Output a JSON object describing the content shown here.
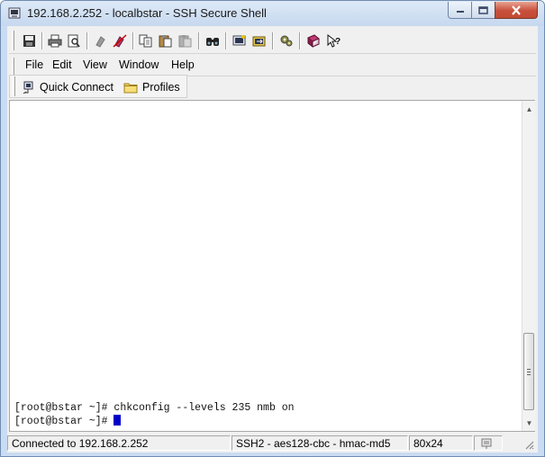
{
  "window": {
    "title": "192.168.2.252 - localbstar - SSH Secure Shell"
  },
  "menu": {
    "items": [
      "File",
      "Edit",
      "View",
      "Window",
      "Help"
    ]
  },
  "linkbar": {
    "quick_connect": "Quick Connect",
    "profiles": "Profiles"
  },
  "terminal": {
    "lines": [
      "[root@bstar ~]# chkconfig --levels 235 nmb on",
      "[root@bstar ~]# "
    ]
  },
  "status": {
    "connection": "Connected to 192.168.2.252",
    "encryption": "SSH2 - aes128-cbc - hmac-md5",
    "size": "80x24"
  },
  "icons": {
    "toolbar": [
      "save-icon",
      "print-icon",
      "print-preview-icon",
      "disconnect-icon",
      "connect-icon",
      "copy-icon",
      "paste-icon",
      "paste-disabled-icon",
      "find-icon",
      "new-terminal-icon",
      "file-transfer-icon",
      "settings-icon",
      "help-book-icon",
      "context-help-icon"
    ]
  },
  "colors": {
    "titlebar": "#c9dcf2",
    "close_button": "#c8503c",
    "cursor": "#0000c8",
    "terminal_bg": "#ffffff"
  }
}
